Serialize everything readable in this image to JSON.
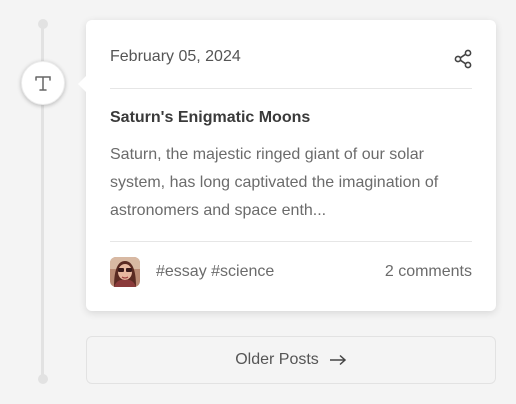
{
  "post": {
    "date": "February 05, 2024",
    "title": "Saturn's Enigmatic Moons",
    "excerpt": "Saturn, the majestic ringed giant of our solar system, has long captivated the imagination of astronomers and space enth...",
    "tags": [
      "#essay",
      "#science"
    ],
    "comments": "2 comments",
    "type_icon": "text-type-icon",
    "share_icon": "share-icon"
  },
  "pagination": {
    "older_label": "Older Posts",
    "arrow_icon": "arrow-right-icon"
  }
}
